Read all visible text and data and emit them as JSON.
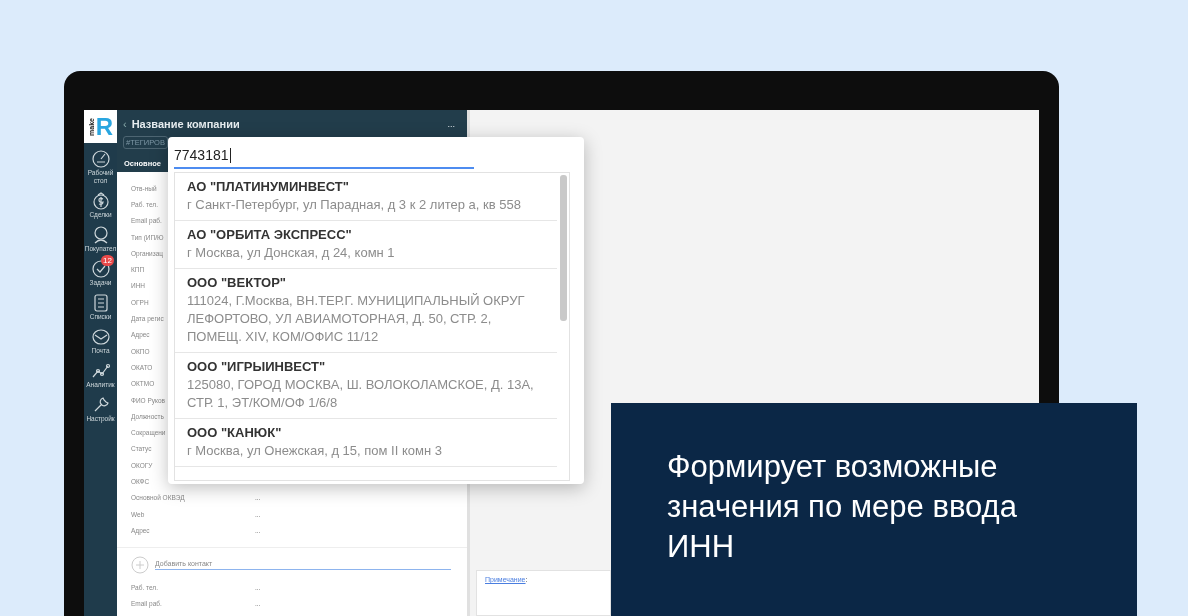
{
  "logo": {
    "small": "make",
    "letter": "R"
  },
  "sidebar": {
    "items": [
      {
        "label": "Рабочий стол"
      },
      {
        "label": "Сделки"
      },
      {
        "label": "Покупател"
      },
      {
        "label": "Задачи",
        "badge": "12"
      },
      {
        "label": "Списки"
      },
      {
        "label": "Почта"
      },
      {
        "label": "Аналитик"
      },
      {
        "label": "Настройк"
      }
    ]
  },
  "panel": {
    "back": "‹",
    "title": "Название компании",
    "more": "...",
    "tags": "#ТЕГИРОВ",
    "tabs": [
      {
        "label": "Основное",
        "selected": true
      }
    ],
    "fields": [
      {
        "label": "Отв-ный"
      },
      {
        "label": "Раб. тел."
      },
      {
        "label": "Email раб."
      },
      {
        "label": "Тип (ИП/Ю"
      },
      {
        "label": "Организац"
      },
      {
        "label": "КПП"
      },
      {
        "label": "ИНН"
      },
      {
        "label": "ОГРН"
      },
      {
        "label": "Дата регис"
      },
      {
        "label": "Адрес"
      },
      {
        "label": "ОКПО"
      },
      {
        "label": "ОКАТО"
      },
      {
        "label": "ОКТМО"
      },
      {
        "label": "ФИО Руков"
      },
      {
        "label": "Должность"
      },
      {
        "label": "Сокращени"
      },
      {
        "label": "Статус"
      },
      {
        "label": "ОКОГУ"
      },
      {
        "label": "ОКФС"
      },
      {
        "label": "Основной ОКВЭД",
        "value": "..."
      },
      {
        "label": "Web",
        "value": "..."
      },
      {
        "label": "Адрес",
        "value": "..."
      }
    ],
    "add_contact": "Добавить контакт",
    "contact_fields": [
      {
        "label": "Раб. тел.",
        "value": "..."
      },
      {
        "label": "Email раб.",
        "value": "..."
      }
    ]
  },
  "note": {
    "link": "Примечание",
    "suffix": ":"
  },
  "suggest": {
    "value": "7743181",
    "items": [
      {
        "title": "АО \"ПЛАТИНУМИНВЕСТ\"",
        "address": "г Санкт-Петербург, ул Парадная, д 3 к 2 литер а, кв 558"
      },
      {
        "title": "АО \"ОРБИТА ЭКСПРЕСС\"",
        "address": "г Москва, ул Донская, д 24, комн 1"
      },
      {
        "title": "ООО \"ВЕКТОР\"",
        "address": "111024, Г.Москва, ВН.ТЕР.Г. МУНИЦИПАЛЬНЫЙ ОКРУГ ЛЕФОРТОВО, УЛ АВИАМОТОРНАЯ, Д. 50, СТР. 2, ПОМЕЩ. XIV, КОМ/ОФИС 11/12"
      },
      {
        "title": "ООО \"ИГРЫИНВЕСТ\"",
        "address": "125080, ГОРОД МОСКВА, Ш. ВОЛОКОЛАМСКОЕ, Д. 13А, СТР. 1, ЭТ/КОМ/ОФ 1/6/8"
      },
      {
        "title": "ООО \"КАНЮК\"",
        "address": "г Москва, ул Онежская, д 15, пом II комн 3"
      }
    ]
  },
  "callout": {
    "text": "Формирует возможные значения по мере ввода ИНН"
  }
}
